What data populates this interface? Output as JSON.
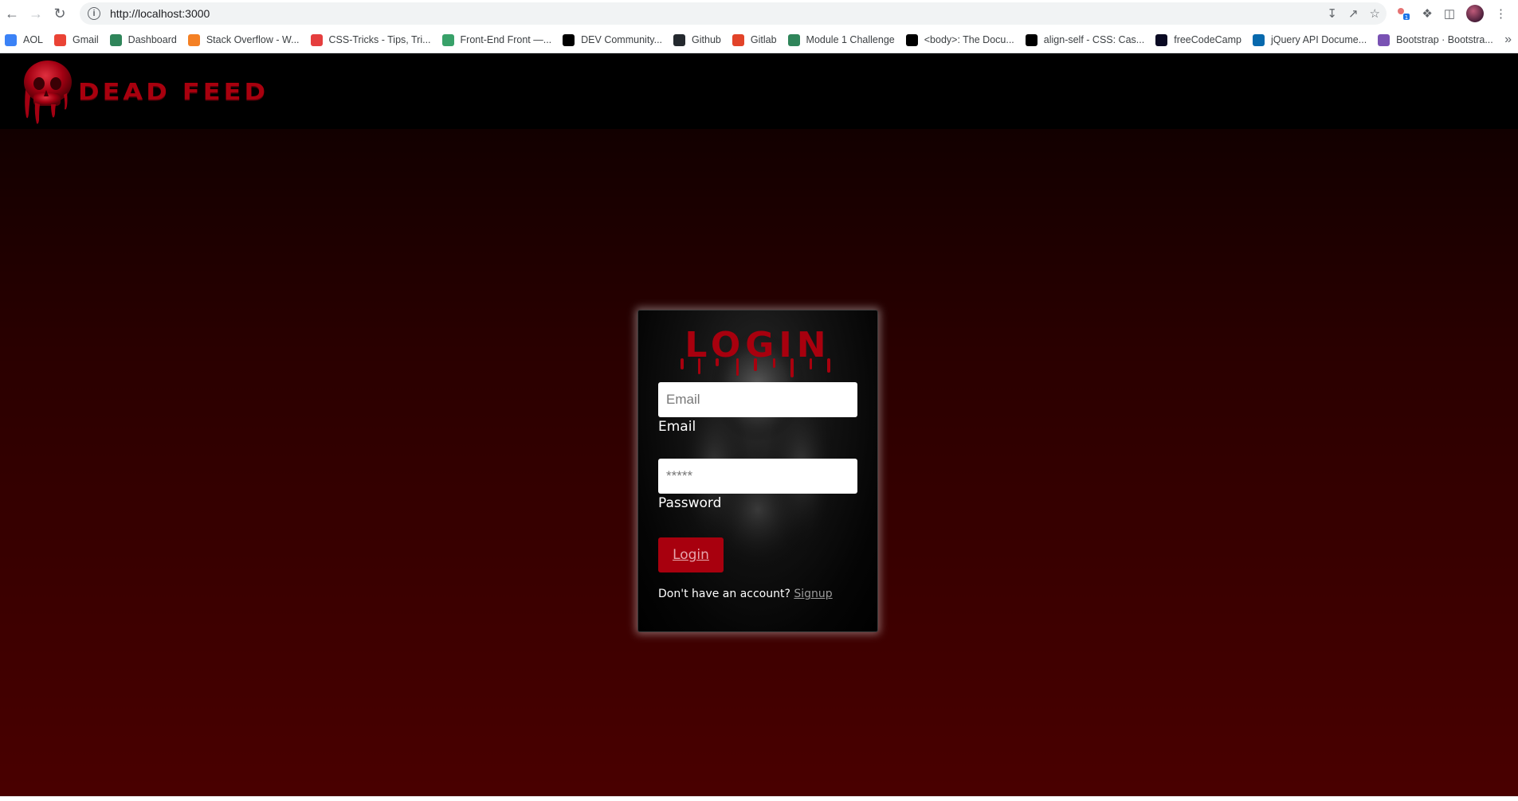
{
  "browser": {
    "url": "http://localhost:3000",
    "bookmarks": [
      {
        "label": "AOL",
        "icon": "aol-icon",
        "color": "#3b82f6"
      },
      {
        "label": "Gmail",
        "icon": "gmail-icon",
        "color": "#ea4335"
      },
      {
        "label": "Dashboard",
        "icon": "dashboard-icon",
        "color": "#2f855a"
      },
      {
        "label": "Stack Overflow - W...",
        "icon": "stackoverflow-icon",
        "color": "#f48024"
      },
      {
        "label": "CSS-Tricks - Tips, Tri...",
        "icon": "csstricks-icon",
        "color": "#e53e3e"
      },
      {
        "label": "Front-End Front —...",
        "icon": "frontend-icon",
        "color": "#38a169"
      },
      {
        "label": "DEV Community...",
        "icon": "dev-icon",
        "color": "#000000"
      },
      {
        "label": "Github",
        "icon": "github-icon",
        "color": "#24292e"
      },
      {
        "label": "Gitlab",
        "icon": "gitlab-icon",
        "color": "#e24329"
      },
      {
        "label": "Module 1 Challenge",
        "icon": "module-icon",
        "color": "#2f855a"
      },
      {
        "label": "<body>: The Docu...",
        "icon": "mdn-icon",
        "color": "#000000"
      },
      {
        "label": "align-self - CSS: Cas...",
        "icon": "mdn-icon",
        "color": "#000000"
      },
      {
        "label": "freeCodeCamp",
        "icon": "freecodecamp-icon",
        "color": "#0a0a23"
      },
      {
        "label": "jQuery API Docume...",
        "icon": "jquery-icon",
        "color": "#0769ad"
      },
      {
        "label": "Bootstrap · Bootstra...",
        "icon": "bootstrap-icon",
        "color": "#7952b3"
      }
    ]
  },
  "site": {
    "logo_text": "DEAD FEED"
  },
  "login": {
    "title": "LOGIN",
    "email_placeholder": "Email",
    "email_label": "Email",
    "password_placeholder": "*****",
    "password_label": "Password",
    "button_label": "Login",
    "signup_prompt": "Don't have an account?",
    "signup_link": "Signup"
  },
  "colors": {
    "accent": "#a8000e",
    "header_bg": "#000000",
    "page_bg_dark": "#0a0000",
    "page_bg_light": "#4a0000"
  }
}
